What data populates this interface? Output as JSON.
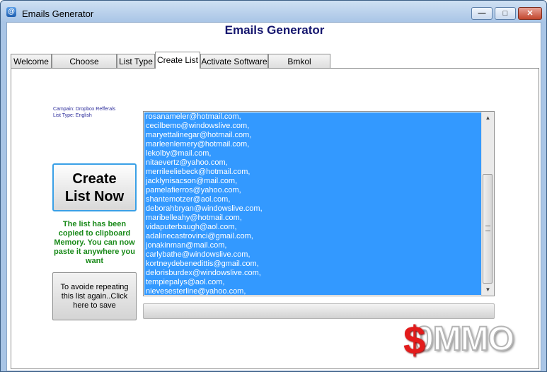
{
  "window": {
    "title": "Emails Generator",
    "icon": "at-sign-icon",
    "controls": {
      "minimize": "—",
      "maximize": "□",
      "close": "✕"
    }
  },
  "header": {
    "title": "Emails Generator"
  },
  "tabs": [
    {
      "label": "Welcome"
    },
    {
      "label": "Choose Campain"
    },
    {
      "label": "List Type"
    },
    {
      "label": "Create List",
      "active": true
    },
    {
      "label": "Activate Software"
    },
    {
      "label": "Bmkol Softwares"
    }
  ],
  "campaign": {
    "campaign_line": "Campain: Dropbox Refferals",
    "list_type_line": "List Type: English"
  },
  "create_button": {
    "line1": "Create",
    "line2": "List Now"
  },
  "copied_message": "The list has been copied to clipboard Memory. You can now paste it anywhere you want",
  "save_button": {
    "label": "To avoide repeating this list again..Click here to save"
  },
  "emails": [
    "rosanameler@hotmail.com,",
    "cecilbemo@windowslive.com,",
    "maryettalinegar@hotmail.com,",
    "marleenlemery@hotmail.com,",
    "lekolby@mail.com,",
    "nitaevertz@yahoo.com,",
    "merrileeliebeck@hotmail.com,",
    "jacklynisacson@mail.com,",
    "pamelafierros@yahoo.com,",
    "shantemotzer@aol.com,",
    "deborahbryan@windowslive.com,",
    "maribelleahy@hotmail.com,",
    "vidaputerbaugh@aol.com,",
    "adalinecastrovinci@gmail.com,",
    "jonakinman@mail.com,",
    "carlybathe@windowslive.com,",
    "kortneydebenedittis@gmail.com,",
    "delorisburdex@windowslive.com,",
    "tempiepalys@aol.com,",
    "nievesesterline@yahoo.com,"
  ],
  "progress": {
    "value": 0
  },
  "logo": {
    "dollar": "$",
    "text": "0MMO"
  },
  "colors": {
    "selection": "#3399ff",
    "header": "#15166e",
    "message": "#1a8a1a"
  }
}
